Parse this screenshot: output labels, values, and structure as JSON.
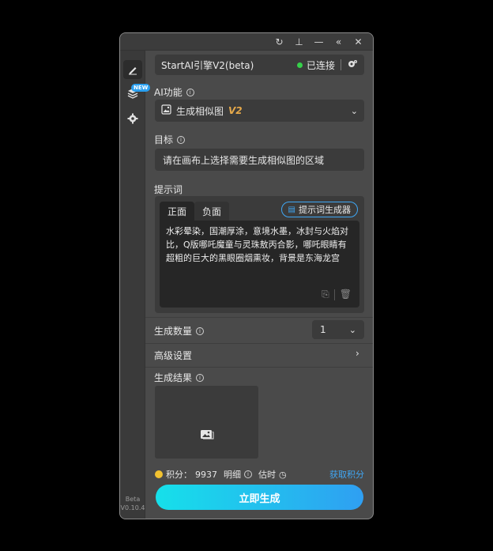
{
  "window_controls": {
    "refresh": "↻",
    "pin": "⊥",
    "minimize": "—",
    "collapse": "«",
    "close": "✕"
  },
  "sidebar": {
    "new_badge": "NEW",
    "version_line1": "Beta",
    "version_line2": "V0.10.4"
  },
  "engine": {
    "name": "StartAI引擎V2(beta)",
    "status": "已连接",
    "status_color": "#36d04a"
  },
  "ai_function": {
    "label": "AI功能",
    "selected": "生成相似图",
    "selected_tag": "V2"
  },
  "target": {
    "label": "目标",
    "value": "请在画布上选择需要生成相似图的区域"
  },
  "prompt": {
    "label": "提示词",
    "tabs": [
      "正面",
      "负面"
    ],
    "generator_button": "提示词生成器",
    "text": "水彩晕染，国潮厚涂，意境水墨，冰封与火焰对比，Q版哪吒魔童与灵珠敖丙合影，哪吒眼睛有超粗的巨大的黑眼圈烟熏妆，背景是东海龙宫"
  },
  "generate_count": {
    "label": "生成数量",
    "value": "1"
  },
  "advanced": {
    "label": "高级设置"
  },
  "result": {
    "label": "生成结果"
  },
  "points": {
    "label": "积分：",
    "value": "9937",
    "detail": "明细",
    "estimate": "估时",
    "get_points": "获取积分"
  },
  "generate_button": "立即生成",
  "colors": {
    "accent": "#3fa7f5",
    "v2_tag": "#e6a94a",
    "coin": "#f2c230"
  }
}
